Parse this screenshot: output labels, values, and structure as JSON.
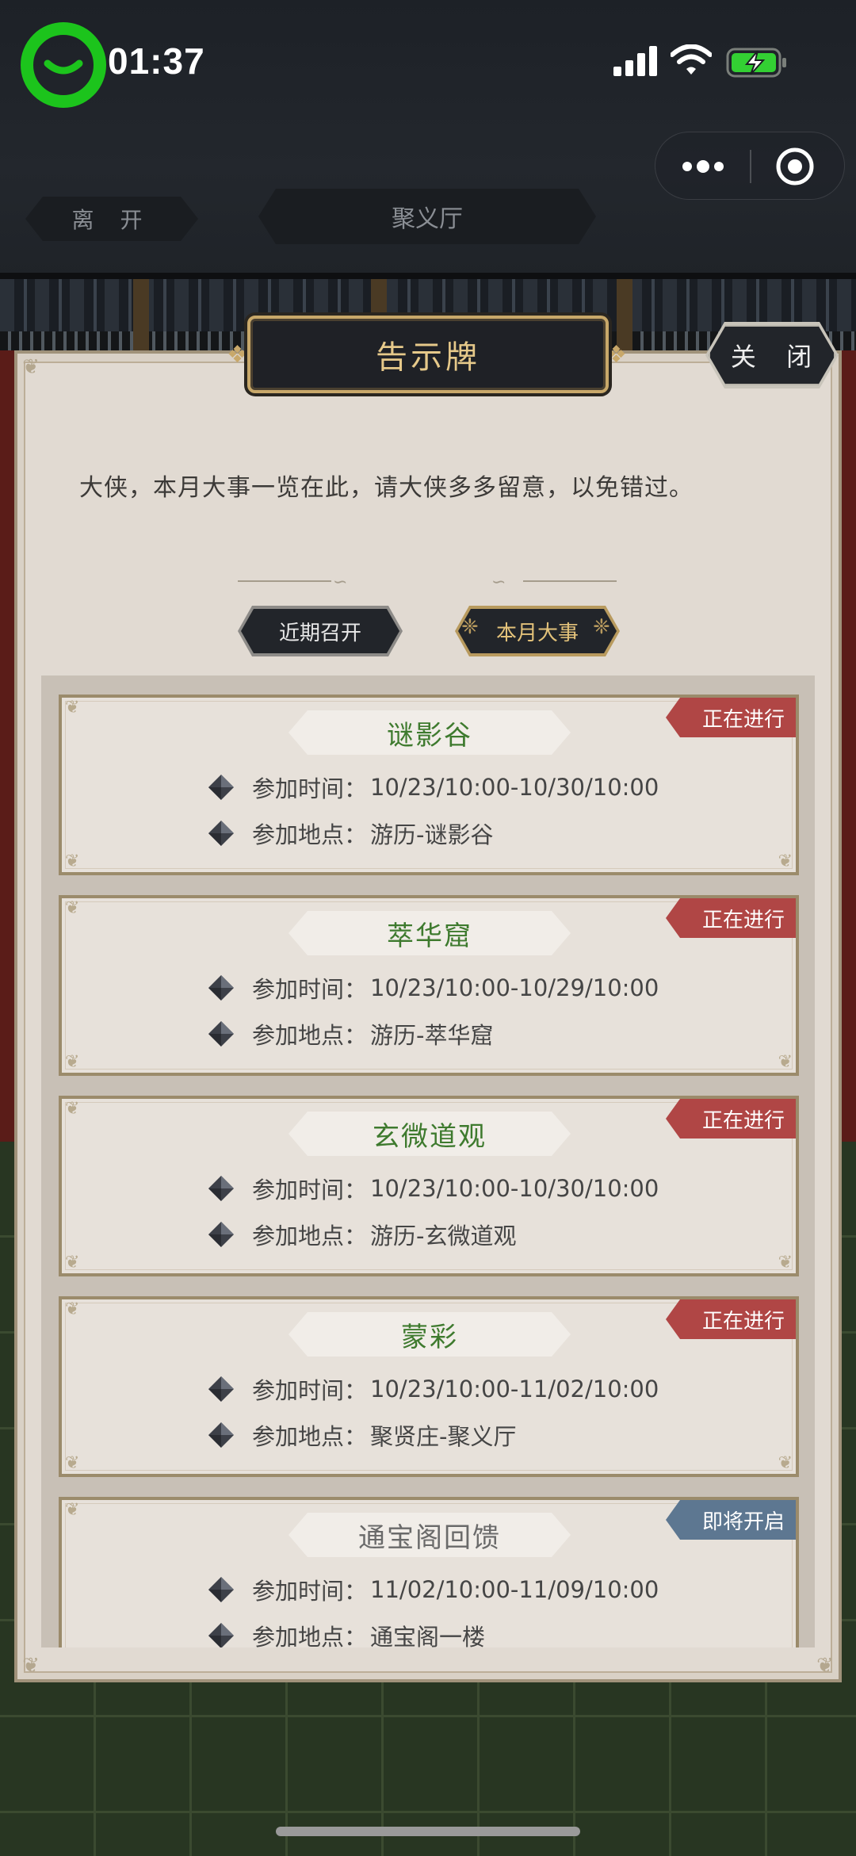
{
  "status_bar": {
    "time": "01:37",
    "signal_icon": "signal-bars-icon",
    "wifi_icon": "wifi-icon",
    "battery_icon": "battery-charging-icon",
    "app_icon": "chat-bubble-ring-icon"
  },
  "capsule": {
    "more_icon": "more-dots-icon",
    "close_icon": "target-circle-icon"
  },
  "nav": {
    "leave_label": "离 开",
    "hall_label": "聚义厅"
  },
  "panel": {
    "title": "告示牌",
    "close_label": "关 闭",
    "intro": "大侠，本月大事一览在此，请大侠多多留意，以免错过。",
    "tabs": [
      {
        "label": "近期召开",
        "selected": false
      },
      {
        "label": "本月大事",
        "selected": true
      }
    ]
  },
  "events": [
    {
      "name": "谜影谷",
      "status": "正在进行",
      "time_label": "参加时间：",
      "time": "10/23/10:00-10/30/10:00",
      "place_label": "参加地点：",
      "place": "游历-谜影谷"
    },
    {
      "name": "萃华窟",
      "status": "正在进行",
      "time_label": "参加时间：",
      "time": "10/23/10:00-10/29/10:00",
      "place_label": "参加地点：",
      "place": "游历-萃华窟"
    },
    {
      "name": "玄微道观",
      "status": "正在进行",
      "time_label": "参加时间：",
      "time": "10/23/10:00-10/30/10:00",
      "place_label": "参加地点：",
      "place": "游历-玄微道观"
    },
    {
      "name": "蒙彩",
      "status": "正在进行",
      "time_label": "参加时间：",
      "time": "10/23/10:00-11/02/10:00",
      "place_label": "参加地点：",
      "place": "聚贤庄-聚义厅"
    },
    {
      "name": "通宝阁回馈",
      "status": "即将开启",
      "time_label": "参加时间：",
      "time": "11/02/10:00-11/09/10:00",
      "place_label": "参加地点：",
      "place": "通宝阁一楼"
    }
  ],
  "colors": {
    "active_badge": "#b04645",
    "upcoming_badge": "#5d7791",
    "active_name": "#3e7a2e",
    "title_gold": "#e6c98a"
  }
}
